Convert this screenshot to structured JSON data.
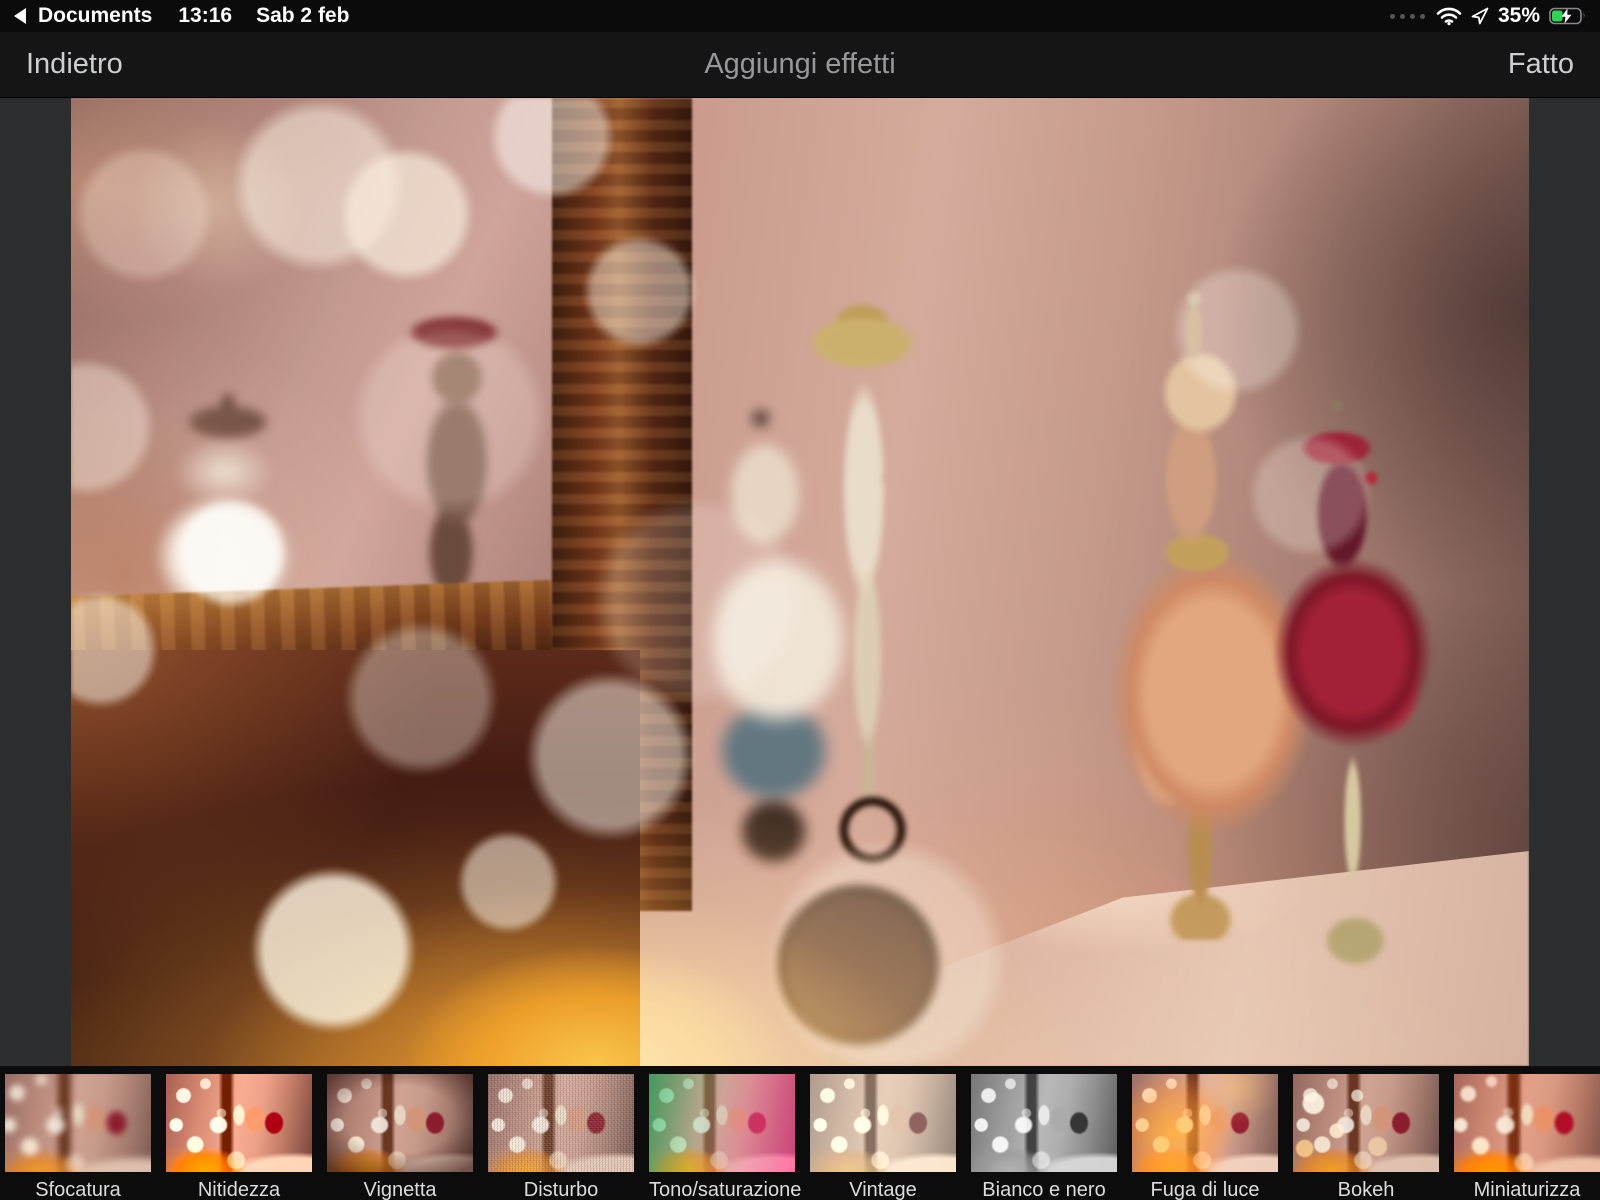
{
  "status_bar": {
    "back_app": "Documents",
    "time": "13:16",
    "date": "Sab 2 feb",
    "battery_level": "35%"
  },
  "nav_bar": {
    "back": "Indietro",
    "title": "Aggiungi effetti",
    "done": "Fatto"
  },
  "filters": [
    {
      "id": "sfocatura",
      "label": "Sfocatura"
    },
    {
      "id": "nitidezza",
      "label": "Nitidezza"
    },
    {
      "id": "vignetta",
      "label": "Vignetta"
    },
    {
      "id": "disturbo",
      "label": "Disturbo"
    },
    {
      "id": "tono-saturazione",
      "label": "Tono/saturazione"
    },
    {
      "id": "vintage",
      "label": "Vintage"
    },
    {
      "id": "bianco-e-nero",
      "label": "Bianco e nero"
    },
    {
      "id": "fuga-di-luce",
      "label": "Fuga di luce"
    },
    {
      "id": "bokeh",
      "label": "Bokeh"
    },
    {
      "id": "miniaturizza",
      "label": "Miniaturizza"
    }
  ],
  "colors": {
    "battery_green": "#32d158",
    "status_text": "#ffffff",
    "nav_button_text": "#cdced2",
    "nav_title_text": "#97979c",
    "strip_label_text": "#dcdcde"
  }
}
